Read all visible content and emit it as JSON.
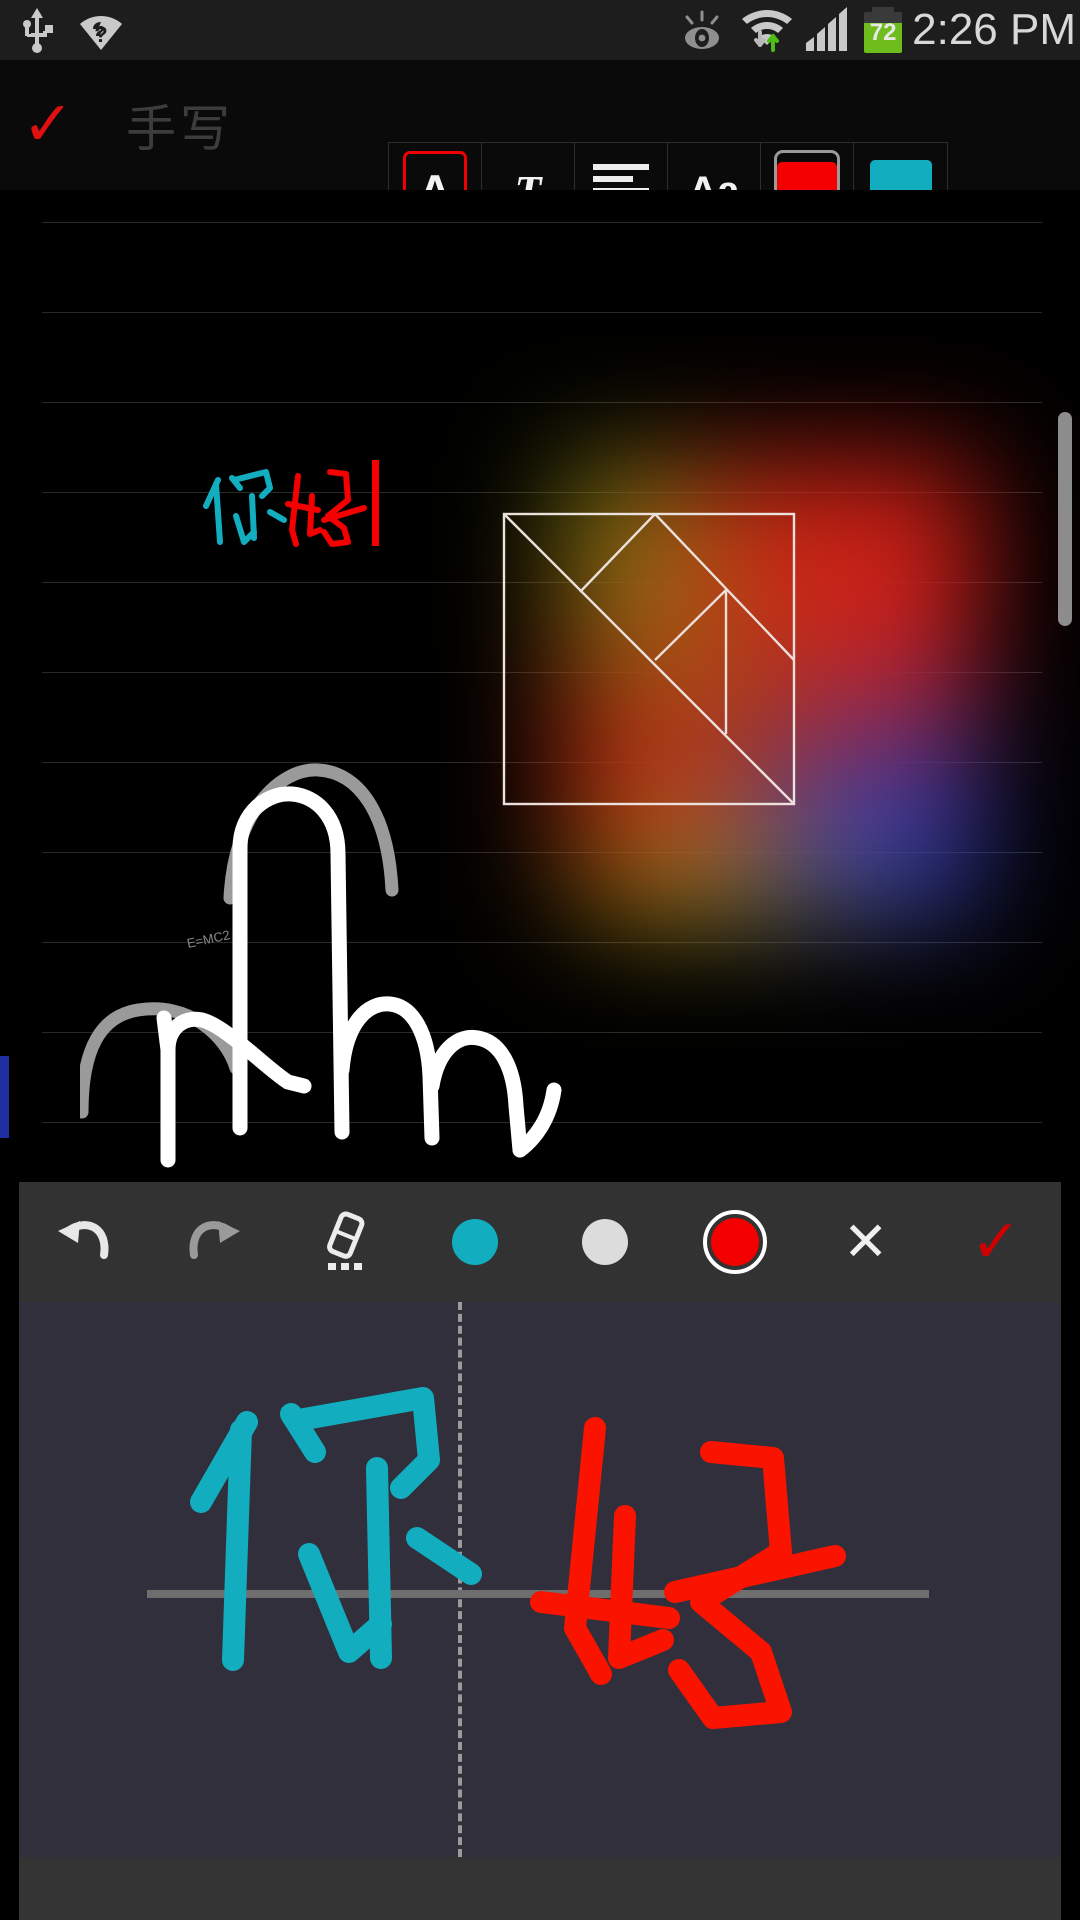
{
  "statusbar": {
    "icons_left": [
      "usb-icon",
      "wifi-question-icon"
    ],
    "icons_right": [
      "smart-stay-eye-icon",
      "wifi-transfer-icon",
      "signal-bars-icon"
    ],
    "battery_percent": "72",
    "time": "2:26 PM"
  },
  "apptoolbar": {
    "confirm_label": "✓",
    "title": "手写",
    "buttons": [
      {
        "name": "text-style-A",
        "glyph": "A",
        "selected": true
      },
      {
        "name": "text-format-T",
        "glyph": "T",
        "has_caret": true
      },
      {
        "name": "paragraph-align",
        "glyph": "",
        "has_caret": false
      },
      {
        "name": "font-size-Aa",
        "glyph": "Aa",
        "has_caret": false
      },
      {
        "name": "text-color-picker",
        "color": "#f40000",
        "has_caret": true
      },
      {
        "name": "highlight-color",
        "color": "#12aec0",
        "has_caret": false
      }
    ],
    "collapse_icon": "chevron-down-icon"
  },
  "note": {
    "inline_handwriting_text": "你好",
    "inline_stroke_colors": [
      "#12aec0",
      "#f40000"
    ],
    "cursor_color": "#f40000",
    "image_name": "tangram-sketch",
    "drawing_name": "hand-gesture-sketch",
    "annotation_text": "E=MC2"
  },
  "handwriting_panel": {
    "toolbar": [
      {
        "name": "undo-button",
        "icon": "undo-icon",
        "label": "↶"
      },
      {
        "name": "redo-button",
        "icon": "redo-icon",
        "label": "↷"
      },
      {
        "name": "eraser-button",
        "icon": "eraser-icon",
        "label": ""
      },
      {
        "name": "color-cyan",
        "icon": "color-dot-icon",
        "color": "#12aec0",
        "selected": false
      },
      {
        "name": "color-white",
        "icon": "color-dot-icon",
        "color": "#dcdcdc",
        "selected": false
      },
      {
        "name": "color-red",
        "icon": "color-dot-icon",
        "color": "#f40000",
        "selected": true
      },
      {
        "name": "cancel-button",
        "icon": "close-icon",
        "label": "✕"
      },
      {
        "name": "accept-button",
        "icon": "check-icon",
        "label": "✓"
      }
    ],
    "canvas_text": "你好",
    "canvas_stroke_colors": [
      "#12aec0",
      "#fa1400"
    ],
    "canvas_bg": "#302f3b",
    "baseline_color": "#6e6e6e",
    "divider_style": "dashed"
  }
}
